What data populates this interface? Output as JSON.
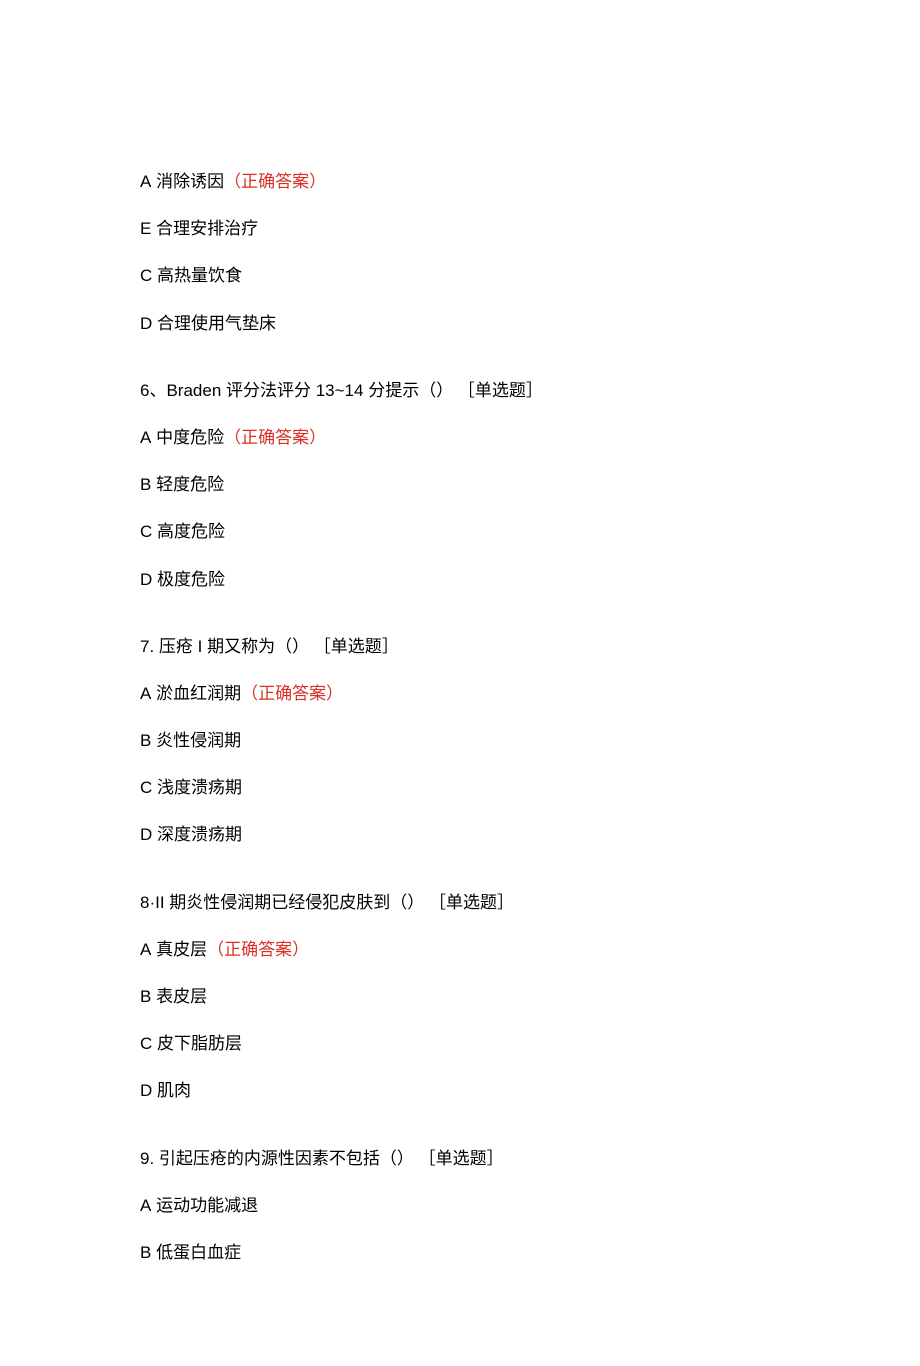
{
  "blocks": [
    {
      "items": [
        {
          "type": "option",
          "label": "A",
          "text": " 消除诱因",
          "correct": true,
          "correctLabel": "（正确答案）"
        },
        {
          "type": "option",
          "label": "E",
          "text": " 合理安排治疗"
        },
        {
          "type": "option",
          "label": "C",
          "text": " 高热量饮食"
        },
        {
          "type": "option",
          "label": "D",
          "text": " 合理使用气垫床"
        }
      ]
    },
    {
      "items": [
        {
          "type": "question",
          "text": "6、Braden 评分法评分 13~14 分提示（） ［单选题］"
        },
        {
          "type": "option",
          "label": "A",
          "text": " 中度危险",
          "correct": true,
          "correctLabel": "（正确答案）"
        },
        {
          "type": "option",
          "label": "B",
          "text": " 轻度危险"
        },
        {
          "type": "option",
          "label": "C",
          "text": " 高度危险"
        },
        {
          "type": "option",
          "label": "D",
          "text": " 极度危险"
        }
      ]
    },
    {
      "items": [
        {
          "type": "question",
          "text": "7. 压疮 I 期又称为（） ［单选题］"
        },
        {
          "type": "option",
          "label": "A",
          "text": " 淤血红润期",
          "correct": true,
          "correctLabel": "（正确答案）"
        },
        {
          "type": "option",
          "label": "B",
          "text": " 炎性侵润期"
        },
        {
          "type": "option",
          "label": "C",
          "text": " 浅度溃疡期"
        },
        {
          "type": "option",
          "label": "D",
          "text": " 深度溃疡期"
        }
      ]
    },
    {
      "items": [
        {
          "type": "question",
          "text": "8·II 期炎性侵润期已经侵犯皮肤到（） ［单选题］"
        },
        {
          "type": "option",
          "label": "A",
          "text": " 真皮层",
          "correct": true,
          "correctLabel": "（正确答案）"
        },
        {
          "type": "option",
          "label": "B",
          "text": " 表皮层"
        },
        {
          "type": "option",
          "label": "C",
          "text": " 皮下脂肪层"
        },
        {
          "type": "option",
          "label": "D",
          "text": " 肌肉"
        }
      ]
    },
    {
      "items": [
        {
          "type": "question",
          "text": "9. 引起压疮的内源性因素不包括（） ［单选题］"
        },
        {
          "type": "option",
          "label": "A",
          "text": " 运动功能减退"
        },
        {
          "type": "option",
          "label": "B",
          "text": " 低蛋白血症"
        }
      ]
    }
  ]
}
